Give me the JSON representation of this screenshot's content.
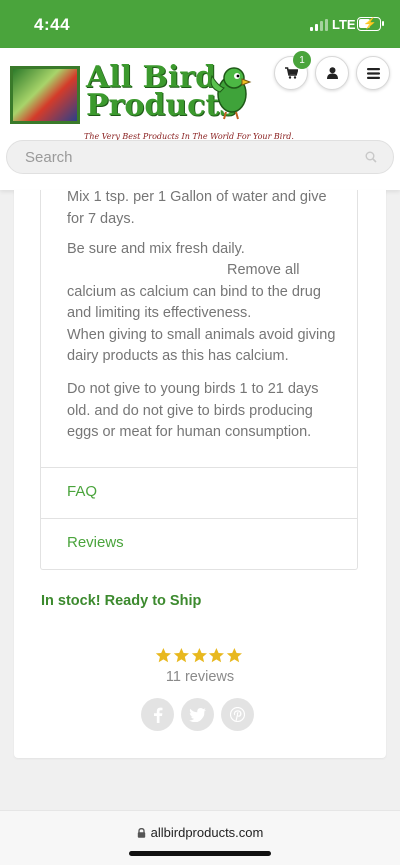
{
  "status_bar": {
    "time": "4:44",
    "network": "LTE",
    "battery_level": 0.6
  },
  "header": {
    "logo_title_line1": "All Bird",
    "logo_title_line2": "Products",
    "logo_tagline": "The Very Best Products In The World For Your Bird.",
    "cart_count": "1",
    "search_placeholder": "Search"
  },
  "description": {
    "paragraph1": "Mix 1 tsp. per 1 Gallon of water and give for 7 days.",
    "paragraph2_line1": "Be sure and mix fresh daily.",
    "paragraph2_rest_indented": "Remove all",
    "paragraph2_rest": "calcium as calcium can bind to the drug and limiting its effectiveness.",
    "paragraph2_rest2": "When giving to small animals avoid giving dairy products as this has calcium.",
    "paragraph3": "Do not give to young birds 1 to 21 days old. and do not give to birds producing eggs or meat for human consumption."
  },
  "accordion": [
    {
      "label": "FAQ"
    },
    {
      "label": "Reviews"
    }
  ],
  "stock_status": "In stock! Ready to Ship",
  "rating": {
    "stars": 5,
    "reviews_text": "11 reviews"
  },
  "share": [
    "facebook-icon",
    "twitter-icon",
    "pinterest-icon"
  ],
  "browser": {
    "url": "allbirdproducts.com"
  },
  "colors": {
    "brand_green": "#4aa43c",
    "star_gold": "#e8b81e",
    "link_green": "#4aa43c"
  }
}
